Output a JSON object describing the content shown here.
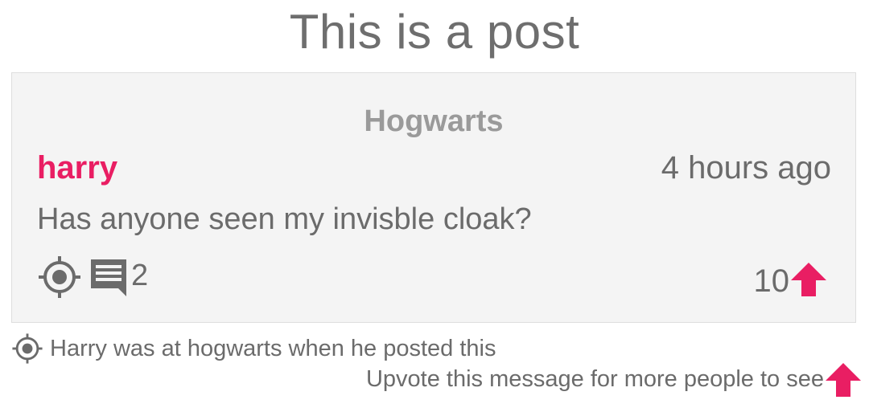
{
  "page": {
    "title": "This is a post"
  },
  "post": {
    "location": "Hogwarts",
    "author": "harry",
    "time_ago": "4 hours ago",
    "message": "Has anyone seen my invisble cloak?",
    "comment_count": "2",
    "vote_count": "10"
  },
  "legend": {
    "location_text": "Harry was at hogwarts when he posted this",
    "upvote_text": "Upvote this message for more people to see"
  },
  "icons": {
    "location": "my-location-icon",
    "comment": "comment-icon",
    "upvote": "arrow-up-icon"
  },
  "colors": {
    "accent": "#e91e63",
    "text": "#6b6b6b",
    "card_background": "#f4f4f4",
    "card_border": "#dedede",
    "location_title": "#9a9a9a"
  }
}
